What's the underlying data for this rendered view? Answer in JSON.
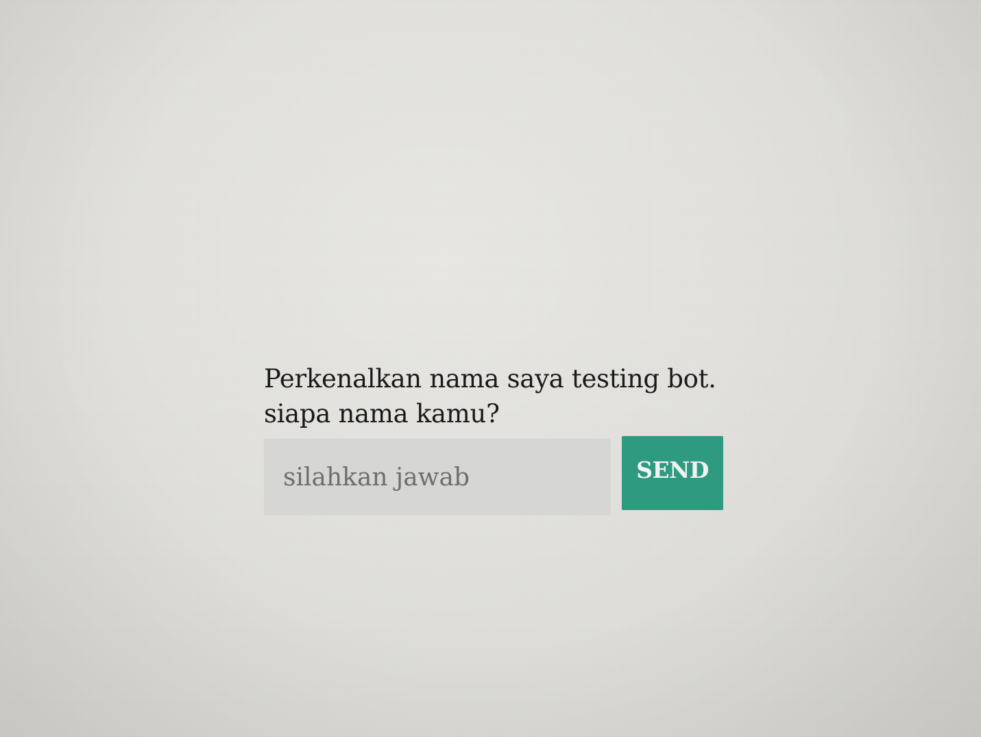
{
  "chat": {
    "bot_message_line1": "Perkenalkan nama saya testing bot.",
    "bot_message_line2": "siapa nama kamu?"
  },
  "answer_form": {
    "input_placeholder": "silahkan jawab",
    "input_value": "",
    "send_label": "SEND"
  },
  "colors": {
    "send_button": "#2e9a80",
    "input_background": "#d6d6d4",
    "page_background": "#e4e3df"
  }
}
